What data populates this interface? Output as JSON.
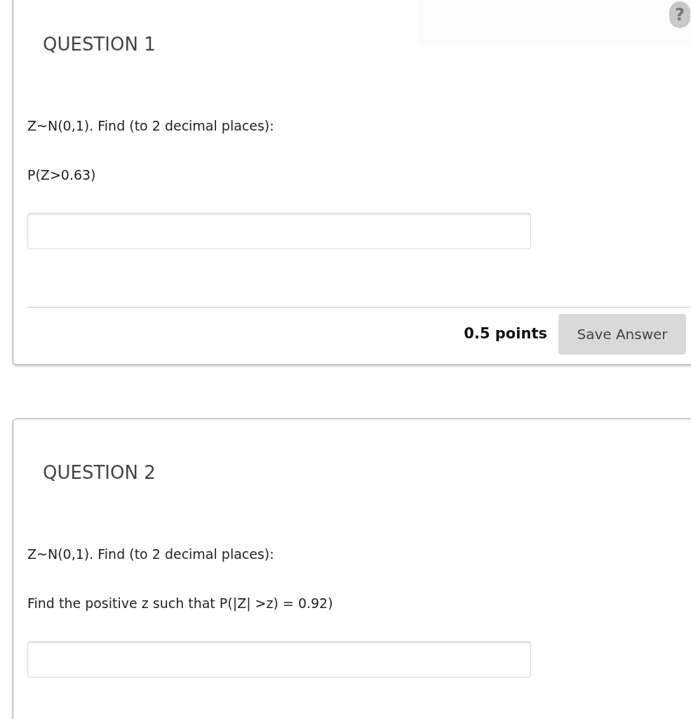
{
  "help_button": {
    "label": "?"
  },
  "questions": [
    {
      "title": "QUESTION 1",
      "prompt": "Z~N(0,1). Find (to 2 decimal places):",
      "sub_prompt": "P(Z>0.63)",
      "points": "0.5 points",
      "save_button": "Save Answer"
    },
    {
      "title": "QUESTION 2",
      "prompt": "Z~N(0,1). Find (to 2 decimal places):",
      "sub_prompt": "Find the positive z such that P(|Z| >z) = 0.92)"
    }
  ]
}
